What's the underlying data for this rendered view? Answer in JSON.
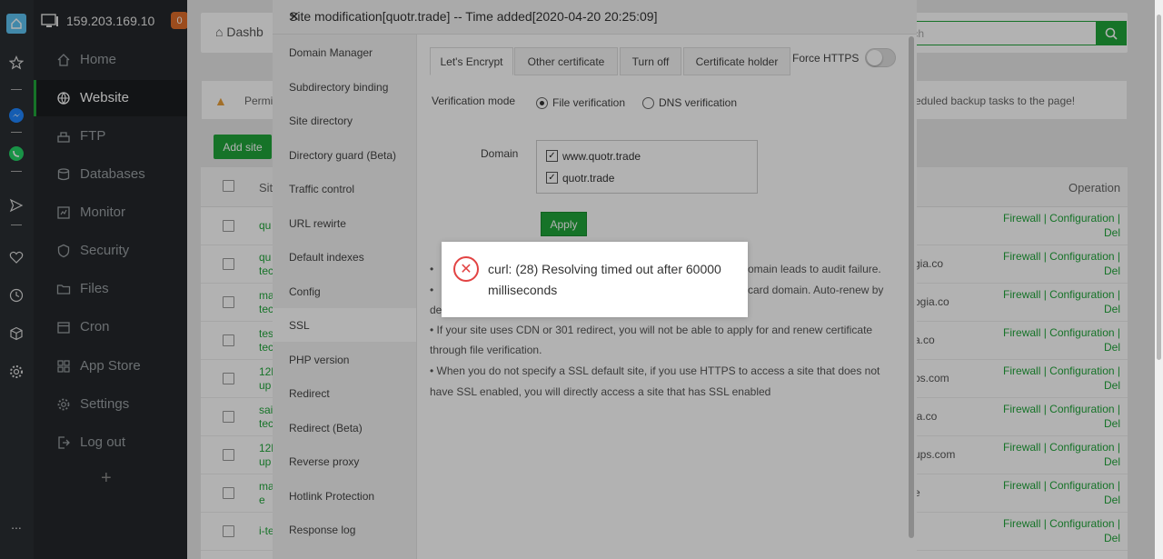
{
  "launcher": {
    "icons": [
      "home-icon",
      "star-icon",
      "messenger-icon",
      "whatsapp-icon",
      "send-icon",
      "heart-icon",
      "clock-icon",
      "cube-icon",
      "gear-icon"
    ],
    "more": "..."
  },
  "server": {
    "ip": "159.203.169.10",
    "badge": "0"
  },
  "nav": [
    {
      "label": "Home",
      "icon": "home-icon"
    },
    {
      "label": "Website",
      "icon": "globe-icon"
    },
    {
      "label": "FTP",
      "icon": "ftp-icon"
    },
    {
      "label": "Databases",
      "icon": "database-icon"
    },
    {
      "label": "Monitor",
      "icon": "monitor-icon"
    },
    {
      "label": "Security",
      "icon": "shield-icon"
    },
    {
      "label": "Files",
      "icon": "folder-icon"
    },
    {
      "label": "Cron",
      "icon": "calendar-icon"
    },
    {
      "label": "App Store",
      "icon": "grid-icon"
    },
    {
      "label": "Settings",
      "icon": "gear-icon"
    },
    {
      "label": "Log out",
      "icon": "logout-icon"
    }
  ],
  "add_icon": "+",
  "page": {
    "breadcrumb": "Dashb",
    "search_placeholder": "earch",
    "alert_left": "Permi",
    "alert_right": "eduled backup tasks to the page!",
    "add_site": "Add site",
    "col_site": "Site",
    "col_operation": "Operation"
  },
  "rows": [
    {
      "site": "qu",
      "site2": "",
      "tail": ""
    },
    {
      "site": "qu",
      "site2": "tec",
      "tail": "gia.co"
    },
    {
      "site": "ma",
      "site2": "tec",
      "tail": "ogia.co"
    },
    {
      "site": "tes",
      "site2": "tec",
      "tail": "a.co"
    },
    {
      "site": "12l",
      "site2": "up",
      "tail": "ps.com"
    },
    {
      "site": "sai",
      "site2": "tec",
      "tail": "ia.co"
    },
    {
      "site": "12l",
      "site2": "up",
      "tail": "ups.com"
    },
    {
      "site": "ma",
      "site2": "e",
      "tail": "e"
    },
    {
      "site": "i-te",
      "site2": "",
      "tail": ""
    }
  ],
  "row_ops": {
    "line1": "Firewall | Configuration |",
    "line2": "Del"
  },
  "modal": {
    "title": "Site modification[quotr.trade] -- Time added[2020-04-20 20:25:09]",
    "close": "✕",
    "menu": [
      "Domain Manager",
      "Subdirectory binding",
      "Site directory",
      "Directory guard (Beta)",
      "Traffic control",
      "URL rewirte",
      "Default indexes",
      "Config",
      "SSL",
      "PHP version",
      "Redirect",
      "Redirect (Beta)",
      "Reverse proxy",
      "Hotlink Protection",
      "Response log"
    ],
    "tabs": [
      "Let's Encrypt",
      "Other certificate",
      "Turn off",
      "Certificate holder"
    ],
    "force_https": "Force HTTPS",
    "verification_label": "Verification mode",
    "file_verification": "File verification",
    "dns_verification": "DNS verification",
    "domain_label": "Domain",
    "domains": [
      "www.quotr.trade",
      "quotr.trade"
    ],
    "apply": "Apply",
    "notes": [
      {
        "a": "•",
        "b": "omain leads to audit failure."
      },
      {
        "a": "•",
        "b": "card domain. Auto-renew by"
      },
      {
        "a": "de",
        "b": ""
      },
      {
        "a": "•   If your site uses CDN or 301 redirect, you will not be able to apply for and renew certificate",
        "b": ""
      },
      {
        "a": "through file verification.",
        "b": ""
      },
      {
        "a": "•   When you do not specify a SSL default site, if you use HTTPS to access a site that does not",
        "b": ""
      },
      {
        "a": "have SSL enabled, you will directly access a site that has SSL enabled",
        "b": ""
      }
    ]
  },
  "error": {
    "message": "curl: (28) Resolving timed out after 60000 milliseconds",
    "icon": "error-x-icon"
  }
}
